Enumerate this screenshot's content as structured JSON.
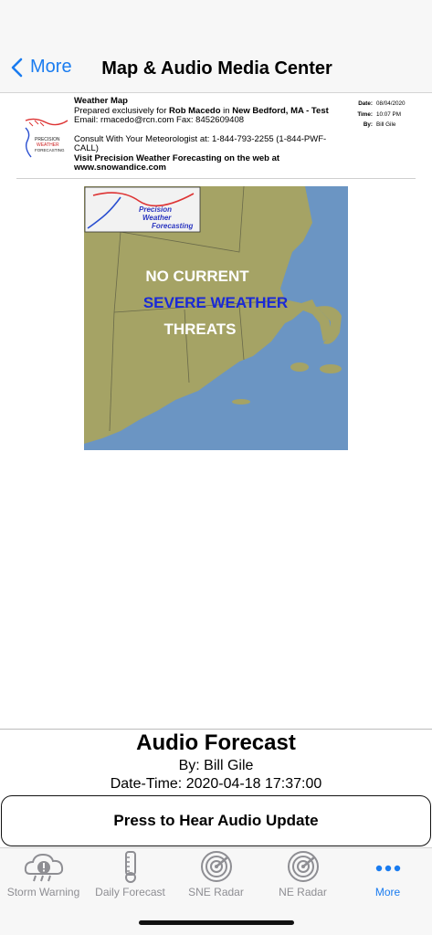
{
  "nav": {
    "back_label": "More",
    "title": "Map & Audio Media Center"
  },
  "header": {
    "logo_text": "Precision Weather Forecasting",
    "doc_title": "Weather Map",
    "prepared_prefix": "Prepared exclusively for ",
    "client_name": "Rob Macedo",
    "in_word": " in ",
    "location": "New Bedford, MA - Test",
    "email_line": "Email: rmacedo@rcn.com Fax: 8452609408",
    "consult_line": "Consult With Your Meteorologist at: 1-844-793-2255 (1-844-PWF-CALL)",
    "visit_line": "Visit Precision Weather Forecasting on the web at www.snowandice.com",
    "date_label": "Date:",
    "date_value": "08/04/2020",
    "time_label": "Time:",
    "time_value": "10:07 PM",
    "by_label": "By:",
    "by_value": "Bill Gile"
  },
  "map": {
    "logo_text_1": "Precision",
    "logo_text_2": "Weather",
    "logo_text_3": "Forecasting",
    "line1": "NO  CURRENT",
    "line2": "SEVERE  WEATHER",
    "line3": "THREATS",
    "colors": {
      "land": "#a5a365",
      "water": "#6b95c3",
      "line2": "#1a2ad6"
    }
  },
  "audio": {
    "title": "Audio Forecast",
    "by": "By: Bill Gile",
    "datetime": "Date-Time: 2020-04-18 17:37:00",
    "button_label": "Press to Hear  Audio Update"
  },
  "tabs": [
    {
      "label": "Storm Warning",
      "icon": "storm-warning-icon"
    },
    {
      "label": "Daily Forecast",
      "icon": "thermometer-icon"
    },
    {
      "label": "SNE Radar",
      "icon": "radar-icon"
    },
    {
      "label": "NE Radar",
      "icon": "radar-icon"
    },
    {
      "label": "More",
      "icon": "more-dots-icon",
      "active": true
    }
  ],
  "colors": {
    "accent": "#1a7cf0",
    "inactive": "#8e8e93"
  }
}
